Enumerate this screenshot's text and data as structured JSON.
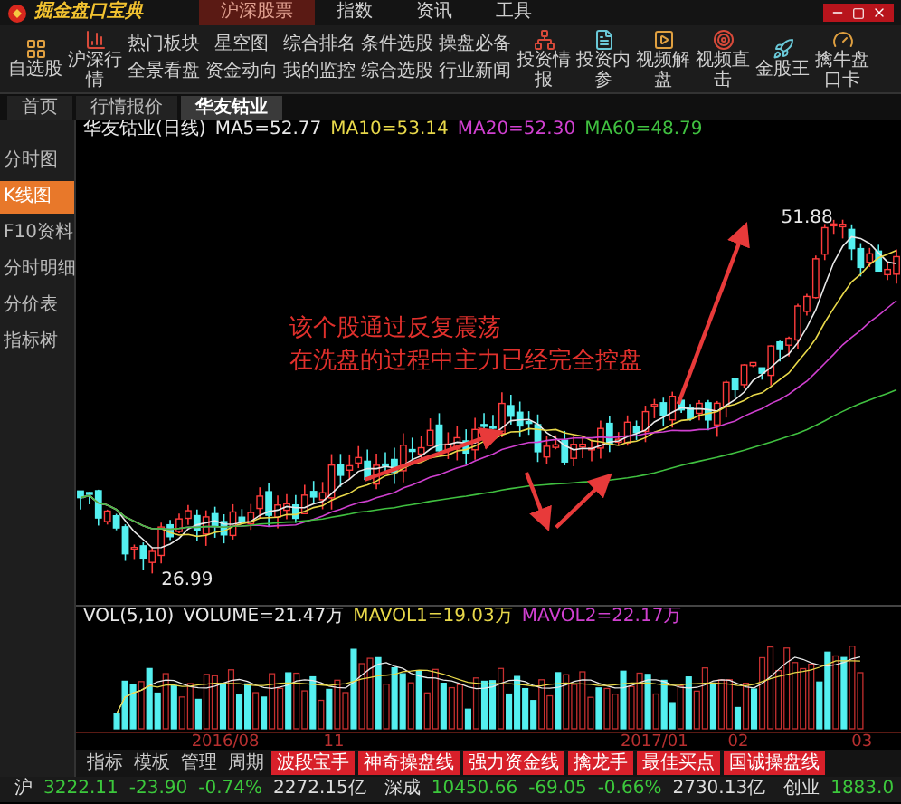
{
  "window": {
    "logo": "掘金盘口宝典",
    "menu": [
      {
        "label": "沪深股票",
        "selected": true
      },
      {
        "label": "指数",
        "selected": false
      },
      {
        "label": "资讯",
        "selected": false
      },
      {
        "label": "工具",
        "selected": false
      }
    ]
  },
  "toolbar": {
    "items": [
      {
        "kind": "icon",
        "label": "自选股"
      },
      {
        "kind": "icon",
        "label": "沪深行情"
      },
      {
        "kind": "pair",
        "labels": [
          "热门板块",
          "全景看盘"
        ]
      },
      {
        "kind": "pair",
        "labels": [
          "星空图",
          "资金动向"
        ]
      },
      {
        "kind": "pair",
        "labels": [
          "综合排名",
          "我的监控"
        ]
      },
      {
        "kind": "pair",
        "labels": [
          "条件选股",
          "综合选股"
        ]
      },
      {
        "kind": "pair",
        "labels": [
          "操盘必备",
          "行业新闻"
        ]
      },
      {
        "kind": "icon",
        "label": "投资情报"
      },
      {
        "kind": "icon",
        "label": "投资内参"
      },
      {
        "kind": "icon",
        "label": "视频解盘"
      },
      {
        "kind": "icon",
        "label": "视频直击"
      },
      {
        "kind": "icon",
        "label": "金股王"
      },
      {
        "kind": "icon",
        "label": "擒牛盘口卡"
      }
    ]
  },
  "tabs": [
    {
      "label": "首页",
      "selected": false
    },
    {
      "label": "行情报价",
      "selected": false
    },
    {
      "label": "华友钴业",
      "selected": true
    }
  ],
  "sidebar": {
    "items": [
      {
        "label": "分时图",
        "selected": false
      },
      {
        "label": "K线图",
        "selected": true
      },
      {
        "label": "F10资料",
        "selected": false
      },
      {
        "label": "分时明细",
        "selected": false
      },
      {
        "label": "分价表",
        "selected": false
      },
      {
        "label": "指标树",
        "selected": false
      }
    ]
  },
  "chart": {
    "title": "华友钴业(日线)",
    "indicators": [
      {
        "text": "MA5=52.77",
        "color": "#e8e8e8"
      },
      {
        "text": "MA10=53.14",
        "color": "#e8d84a"
      },
      {
        "text": "MA20=52.30",
        "color": "#d040d0"
      },
      {
        "text": "MA60=48.79",
        "color": "#40c040"
      }
    ],
    "high_label": "51.88",
    "low_label": "26.99",
    "annotation": [
      "该个股通过反复震荡",
      "在洗盘的过程中主力已经完全控盘"
    ]
  },
  "volume": {
    "indicators": [
      {
        "text": "VOL(5,10)",
        "color": "#e8e8e8"
      },
      {
        "text": "VOLUME=21.47万",
        "color": "#e8e8e8"
      },
      {
        "text": "MAVOL1=19.03万",
        "color": "#e8d84a"
      },
      {
        "text": "MAVOL2=22.17万",
        "color": "#d040d0"
      }
    ]
  },
  "date_axis": [
    "2016/08",
    "11",
    "2017/01",
    "02",
    "03"
  ],
  "indicator_tabs": [
    {
      "kind": "plain",
      "label": "指标"
    },
    {
      "kind": "plain",
      "label": "模板"
    },
    {
      "kind": "plain",
      "label": "管理"
    },
    {
      "kind": "plain",
      "label": "周期"
    },
    {
      "kind": "feature",
      "label": "波段宝手"
    },
    {
      "kind": "feature",
      "label": "神奇操盘线"
    },
    {
      "kind": "feature",
      "label": "强力资金线"
    },
    {
      "kind": "feature",
      "label": "擒龙手"
    },
    {
      "kind": "feature",
      "label": "最佳买点"
    },
    {
      "kind": "feature",
      "label": "国诚操盘线"
    }
  ],
  "status_bar": {
    "indices": [
      {
        "name": "沪",
        "values": [
          {
            "text": "3222.11",
            "color": "#3cc83c"
          },
          {
            "text": "-23.90",
            "color": "#3cc83c"
          },
          {
            "text": "-0.74%",
            "color": "#3cc83c"
          },
          {
            "text": "2272.15亿",
            "color": "#dddddd"
          }
        ]
      },
      {
        "name": "深成",
        "values": [
          {
            "text": "10450.66",
            "color": "#3cc83c"
          },
          {
            "text": "-69.05",
            "color": "#3cc83c"
          },
          {
            "text": "-0.66%",
            "color": "#3cc83c"
          },
          {
            "text": "2730.13亿",
            "color": "#dddddd"
          }
        ]
      },
      {
        "name": "创业",
        "values": [
          {
            "text": "1883.0",
            "color": "#3cc83c"
          }
        ]
      }
    ]
  }
}
